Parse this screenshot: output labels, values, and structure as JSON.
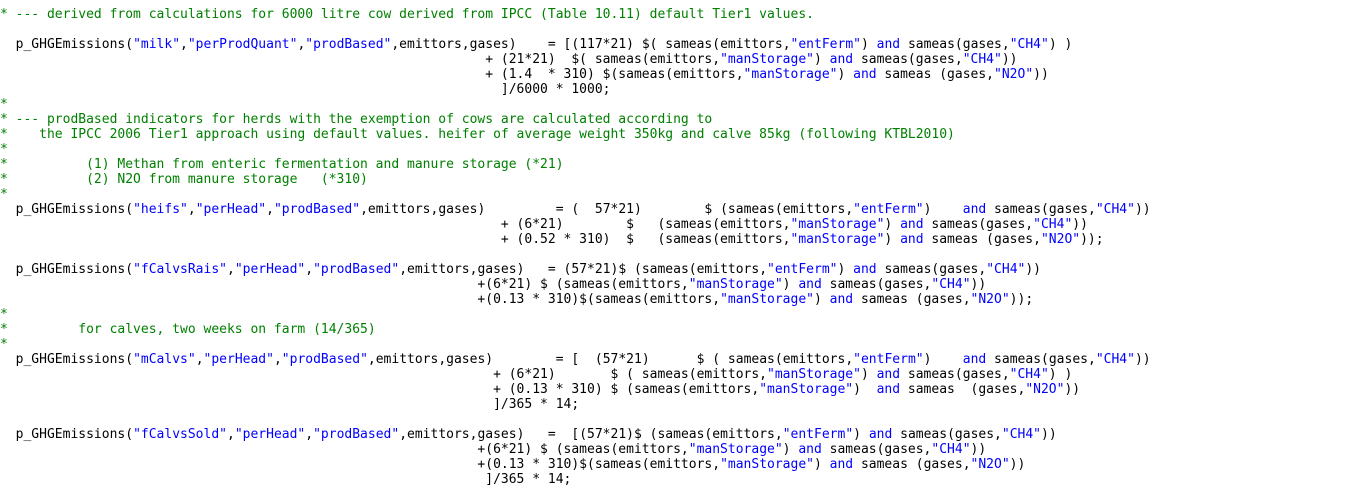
{
  "code_lines": [
    {
      "tokens": [
        {
          "t": "* --- derived from calculations for 6000 litre cow derived from IPCC (Table 10.11) default Tier1 values.",
          "c": "cm"
        }
      ]
    },
    {
      "tokens": [
        {
          "t": "  p_GHGEmissions(",
          "c": "n"
        },
        {
          "t": "\"milk\"",
          "c": "st"
        },
        {
          "t": ",",
          "c": "n"
        },
        {
          "t": "\"perProdQuant\"",
          "c": "st"
        },
        {
          "t": ",",
          "c": "n"
        },
        {
          "t": "\"prodBased\"",
          "c": "st"
        },
        {
          "t": ",emittors,gases)    = [(117*21) $( sameas(emittors,",
          "c": "n"
        },
        {
          "t": "\"entFerm\"",
          "c": "st"
        },
        {
          "t": ") ",
          "c": "n"
        },
        {
          "t": "and",
          "c": "kw"
        },
        {
          "t": " sameas(gases,",
          "c": "n"
        },
        {
          "t": "\"CH4\"",
          "c": "st"
        },
        {
          "t": ") )",
          "c": "n"
        }
      ]
    },
    {
      "tokens": [
        {
          "t": "                                                              + (21*21)  $( sameas(emittors,",
          "c": "n"
        },
        {
          "t": "\"manStorage\"",
          "c": "st"
        },
        {
          "t": ") ",
          "c": "n"
        },
        {
          "t": "and",
          "c": "kw"
        },
        {
          "t": " sameas(gases,",
          "c": "n"
        },
        {
          "t": "\"CH4\"",
          "c": "st"
        },
        {
          "t": "))",
          "c": "n"
        }
      ]
    },
    {
      "tokens": [
        {
          "t": "                                                              + (1.4  * 310) $(sameas(emittors,",
          "c": "n"
        },
        {
          "t": "\"manStorage\"",
          "c": "st"
        },
        {
          "t": ") ",
          "c": "n"
        },
        {
          "t": "and",
          "c": "kw"
        },
        {
          "t": " sameas (gases,",
          "c": "n"
        },
        {
          "t": "\"N2O\"",
          "c": "st"
        },
        {
          "t": "))",
          "c": "n"
        }
      ]
    },
    {
      "tokens": [
        {
          "t": "                                                                ]/6000 * 1000;",
          "c": "n"
        }
      ]
    },
    {
      "tokens": [
        {
          "t": "*",
          "c": "cm"
        }
      ]
    },
    {
      "tokens": [
        {
          "t": "* --- prodBased indicators for herds with the exemption of cows are calculated according to",
          "c": "cm"
        }
      ]
    },
    {
      "tokens": [
        {
          "t": "*    the IPCC 2006 Tier1 approach using default values. heifer of average weight 350kg and calve 85kg (following KTBL2010)",
          "c": "cm"
        }
      ]
    },
    {
      "tokens": [
        {
          "t": "*",
          "c": "cm"
        }
      ]
    },
    {
      "tokens": [
        {
          "t": "*          (1) Methan from enteric fermentation and manure storage (*21)",
          "c": "cm"
        }
      ]
    },
    {
      "tokens": [
        {
          "t": "*          (2) N2O from manure storage   (*310)",
          "c": "cm"
        }
      ]
    },
    {
      "tokens": [
        {
          "t": "*",
          "c": "cm"
        }
      ]
    },
    {
      "tokens": [
        {
          "t": "  p_GHGEmissions(",
          "c": "n"
        },
        {
          "t": "\"heifs\"",
          "c": "st"
        },
        {
          "t": ",",
          "c": "n"
        },
        {
          "t": "\"perHead\"",
          "c": "st"
        },
        {
          "t": ",",
          "c": "n"
        },
        {
          "t": "\"prodBased\"",
          "c": "st"
        },
        {
          "t": ",emittors,gases)         = (  57*21)        $ (sameas(emittors,",
          "c": "n"
        },
        {
          "t": "\"entFerm\"",
          "c": "st"
        },
        {
          "t": ")    ",
          "c": "n"
        },
        {
          "t": "and",
          "c": "kw"
        },
        {
          "t": " sameas(gases,",
          "c": "n"
        },
        {
          "t": "\"CH4\"",
          "c": "st"
        },
        {
          "t": "))",
          "c": "n"
        }
      ]
    },
    {
      "tokens": [
        {
          "t": "                                                                + (6*21)        $   (sameas(emittors,",
          "c": "n"
        },
        {
          "t": "\"manStorage\"",
          "c": "st"
        },
        {
          "t": ") ",
          "c": "n"
        },
        {
          "t": "and",
          "c": "kw"
        },
        {
          "t": " sameas(gases,",
          "c": "n"
        },
        {
          "t": "\"CH4\"",
          "c": "st"
        },
        {
          "t": "))",
          "c": "n"
        }
      ]
    },
    {
      "tokens": [
        {
          "t": "                                                                + (0.52 * 310)  $   (sameas(emittors,",
          "c": "n"
        },
        {
          "t": "\"manStorage\"",
          "c": "st"
        },
        {
          "t": ") ",
          "c": "n"
        },
        {
          "t": "and",
          "c": "kw"
        },
        {
          "t": " sameas (gases,",
          "c": "n"
        },
        {
          "t": "\"N2O\"",
          "c": "st"
        },
        {
          "t": "));",
          "c": "n"
        }
      ]
    },
    {
      "tokens": [
        {
          "t": "",
          "c": "n"
        }
      ]
    },
    {
      "tokens": [
        {
          "t": "  p_GHGEmissions(",
          "c": "n"
        },
        {
          "t": "\"fCalvsRais\"",
          "c": "st"
        },
        {
          "t": ",",
          "c": "n"
        },
        {
          "t": "\"perHead\"",
          "c": "st"
        },
        {
          "t": ",",
          "c": "n"
        },
        {
          "t": "\"prodBased\"",
          "c": "st"
        },
        {
          "t": ",emittors,gases)   = (57*21)$ (sameas(emittors,",
          "c": "n"
        },
        {
          "t": "\"entFerm\"",
          "c": "st"
        },
        {
          "t": ") ",
          "c": "n"
        },
        {
          "t": "and",
          "c": "kw"
        },
        {
          "t": " sameas(gases,",
          "c": "n"
        },
        {
          "t": "\"CH4\"",
          "c": "st"
        },
        {
          "t": "))",
          "c": "n"
        }
      ]
    },
    {
      "tokens": [
        {
          "t": "                                                             +(6*21) $ (sameas(emittors,",
          "c": "n"
        },
        {
          "t": "\"manStorage\"",
          "c": "st"
        },
        {
          "t": ") ",
          "c": "n"
        },
        {
          "t": "and",
          "c": "kw"
        },
        {
          "t": " sameas(gases,",
          "c": "n"
        },
        {
          "t": "\"CH4\"",
          "c": "st"
        },
        {
          "t": "))",
          "c": "n"
        }
      ]
    },
    {
      "tokens": [
        {
          "t": "                                                             +(0.13 * 310)$(sameas(emittors,",
          "c": "n"
        },
        {
          "t": "\"manStorage\"",
          "c": "st"
        },
        {
          "t": ") ",
          "c": "n"
        },
        {
          "t": "and",
          "c": "kw"
        },
        {
          "t": " sameas (gases,",
          "c": "n"
        },
        {
          "t": "\"N2O\"",
          "c": "st"
        },
        {
          "t": "));",
          "c": "n"
        }
      ]
    },
    {
      "tokens": [
        {
          "t": "*",
          "c": "cm"
        }
      ]
    },
    {
      "tokens": [
        {
          "t": "*         for calves, two weeks on farm (14/365)",
          "c": "cm"
        }
      ]
    },
    {
      "tokens": [
        {
          "t": "*",
          "c": "cm"
        }
      ]
    },
    {
      "tokens": [
        {
          "t": "  p_GHGEmissions(",
          "c": "n"
        },
        {
          "t": "\"mCalvs\"",
          "c": "st"
        },
        {
          "t": ",",
          "c": "n"
        },
        {
          "t": "\"perHead\"",
          "c": "st"
        },
        {
          "t": ",",
          "c": "n"
        },
        {
          "t": "\"prodBased\"",
          "c": "st"
        },
        {
          "t": ",emittors,gases)        = [  (57*21)      $ ( sameas(emittors,",
          "c": "n"
        },
        {
          "t": "\"entFerm\"",
          "c": "st"
        },
        {
          "t": ")    ",
          "c": "n"
        },
        {
          "t": "and",
          "c": "kw"
        },
        {
          "t": " sameas(gases,",
          "c": "n"
        },
        {
          "t": "\"CH4\"",
          "c": "st"
        },
        {
          "t": "))",
          "c": "n"
        }
      ]
    },
    {
      "tokens": [
        {
          "t": "                                                               + (6*21)       $ ( sameas(emittors,",
          "c": "n"
        },
        {
          "t": "\"manStorage\"",
          "c": "st"
        },
        {
          "t": ") ",
          "c": "n"
        },
        {
          "t": "and",
          "c": "kw"
        },
        {
          "t": " sameas(gases,",
          "c": "n"
        },
        {
          "t": "\"CH4\"",
          "c": "st"
        },
        {
          "t": ") )",
          "c": "n"
        }
      ]
    },
    {
      "tokens": [
        {
          "t": "                                                               + (0.13 * 310) $ (sameas(emittors,",
          "c": "n"
        },
        {
          "t": "\"manStorage\"",
          "c": "st"
        },
        {
          "t": ")  ",
          "c": "n"
        },
        {
          "t": "and",
          "c": "kw"
        },
        {
          "t": " sameas  (gases,",
          "c": "n"
        },
        {
          "t": "\"N2O\"",
          "c": "st"
        },
        {
          "t": "))",
          "c": "n"
        }
      ]
    },
    {
      "tokens": [
        {
          "t": "                                                               ]/365 * 14;",
          "c": "n"
        }
      ]
    },
    {
      "tokens": [
        {
          "t": "",
          "c": "n"
        }
      ]
    },
    {
      "tokens": [
        {
          "t": "  p_GHGEmissions(",
          "c": "n"
        },
        {
          "t": "\"fCalvsSold\"",
          "c": "st"
        },
        {
          "t": ",",
          "c": "n"
        },
        {
          "t": "\"perHead\"",
          "c": "st"
        },
        {
          "t": ",",
          "c": "n"
        },
        {
          "t": "\"prodBased\"",
          "c": "st"
        },
        {
          "t": ",emittors,gases)   =  [(57*21)$ (sameas(emittors,",
          "c": "n"
        },
        {
          "t": "\"entFerm\"",
          "c": "st"
        },
        {
          "t": ") ",
          "c": "n"
        },
        {
          "t": "and",
          "c": "kw"
        },
        {
          "t": " sameas(gases,",
          "c": "n"
        },
        {
          "t": "\"CH4\"",
          "c": "st"
        },
        {
          "t": "))",
          "c": "n"
        }
      ]
    },
    {
      "tokens": [
        {
          "t": "                                                             +(6*21) $ (sameas(emittors,",
          "c": "n"
        },
        {
          "t": "\"manStorage\"",
          "c": "st"
        },
        {
          "t": ") ",
          "c": "n"
        },
        {
          "t": "and",
          "c": "kw"
        },
        {
          "t": " sameas(gases,",
          "c": "n"
        },
        {
          "t": "\"CH4\"",
          "c": "st"
        },
        {
          "t": "))",
          "c": "n"
        }
      ]
    },
    {
      "tokens": [
        {
          "t": "                                                             +(0.13 * 310)$(sameas(emittors,",
          "c": "n"
        },
        {
          "t": "\"manStorage\"",
          "c": "st"
        },
        {
          "t": ") ",
          "c": "n"
        },
        {
          "t": "and",
          "c": "kw"
        },
        {
          "t": " sameas (gases,",
          "c": "n"
        },
        {
          "t": "\"N2O\"",
          "c": "st"
        },
        {
          "t": "))",
          "c": "n"
        }
      ]
    },
    {
      "tokens": [
        {
          "t": "                                                              ]/365 * 14;",
          "c": "n"
        }
      ]
    }
  ]
}
